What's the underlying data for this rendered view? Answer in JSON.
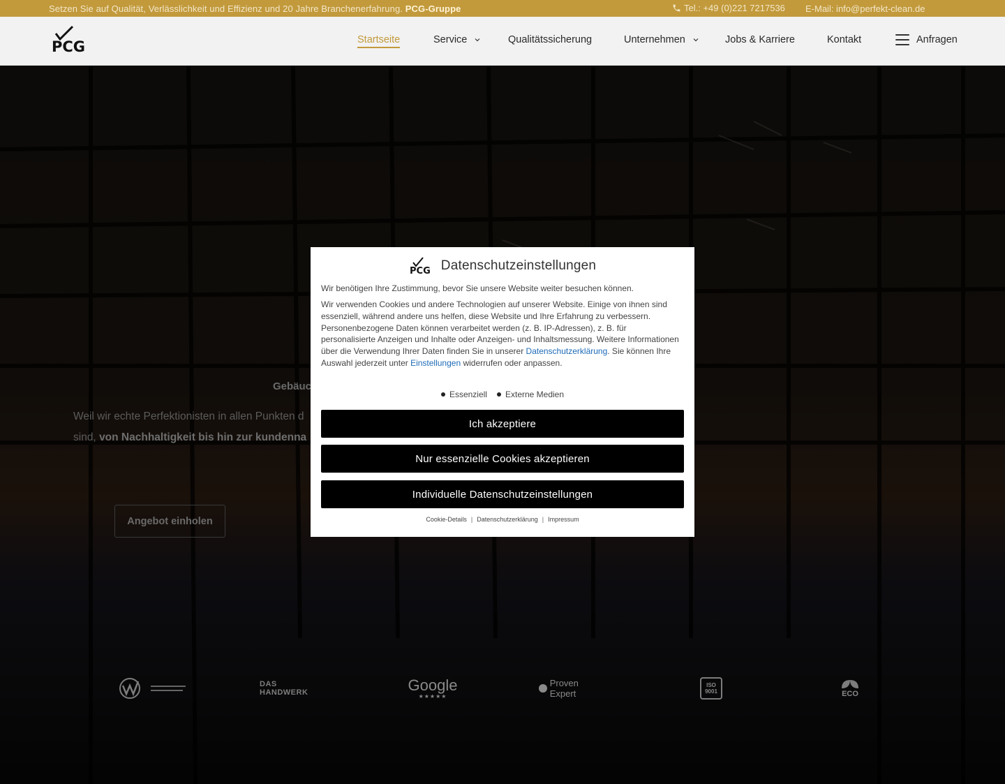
{
  "topbar": {
    "tagline": "Setzen Sie auf Qualität, Verlässlichkeit und Effizienz und 20 Jahre Branchenerfahrung.",
    "brand": "PCG-Gruppe",
    "phone": "Tel.: +49 (0)221 7217536",
    "email": "E-Mail: info@perfekt-clean.de"
  },
  "header": {
    "logo_text": "PCG",
    "nav": [
      {
        "label": "Startseite",
        "active": true
      },
      {
        "label": "Service",
        "dropdown": true
      },
      {
        "label": "Qualitätssicherung"
      },
      {
        "label": "Unternehmen",
        "dropdown": true
      },
      {
        "label": "Jobs & Karriere"
      },
      {
        "label": "Kontakt"
      },
      {
        "label": "Anfragen",
        "icon": "menu-icon"
      }
    ]
  },
  "hero": {
    "subtitle": "Gebäuc",
    "text_plain": "Weil wir echte Perfektionisten in allen Punkten d",
    "text_plain2": "sind, ",
    "text_bold": "von Nachhaltigkeit bis hin zur kundenna",
    "cta": "Angebot einholen",
    "badges": [
      {
        "name": "qualitaetsverbund-logo",
        "text": "Qualitätsverbund Gebäudedienste"
      },
      {
        "name": "handwerk-logo",
        "text": "DAS HANDWERK"
      },
      {
        "name": "google-logo",
        "text": "Google"
      },
      {
        "name": "provenexpert-logo",
        "text": "Proven Expert"
      },
      {
        "name": "iso-9001-logo",
        "text": "ISO 9001"
      },
      {
        "name": "eco-logo",
        "text": "ECO"
      }
    ]
  },
  "modal": {
    "title": "Datenschutzeinstellungen",
    "intro": "Wir benötigen Ihre Zustimmung, bevor Sie unsere Website weiter besuchen können.",
    "body_1": "Wir verwenden Cookies und andere Technologien auf unserer Website. Einige von ihnen sind essenziell, während andere uns helfen, diese Website und Ihre Erfahrung zu verbessern. Personenbezogene Daten können verarbeitet werden (z. B. IP-Adressen), z. B. für personalisierte Anzeigen und Inhalte oder Anzeigen- und Inhaltsmessung. Weitere Informationen über die Verwendung Ihrer Daten finden Sie in unserer ",
    "link_privacy": "Datenschutzerklärung",
    "body_2": ". Sie können Ihre Auswahl jederzeit unter ",
    "link_settings": "Einstellungen",
    "body_3": " widerrufen oder anpassen.",
    "checks": [
      "Essenziell",
      "Externe Medien"
    ],
    "btn_accept": "Ich akzeptiere",
    "btn_essential": "Nur essenzielle Cookies akzeptieren",
    "btn_individual": "Individuelle Datenschutzeinstellungen",
    "footer_links": [
      "Cookie-Details",
      "Datenschutzerklärung",
      "Impressum"
    ]
  }
}
